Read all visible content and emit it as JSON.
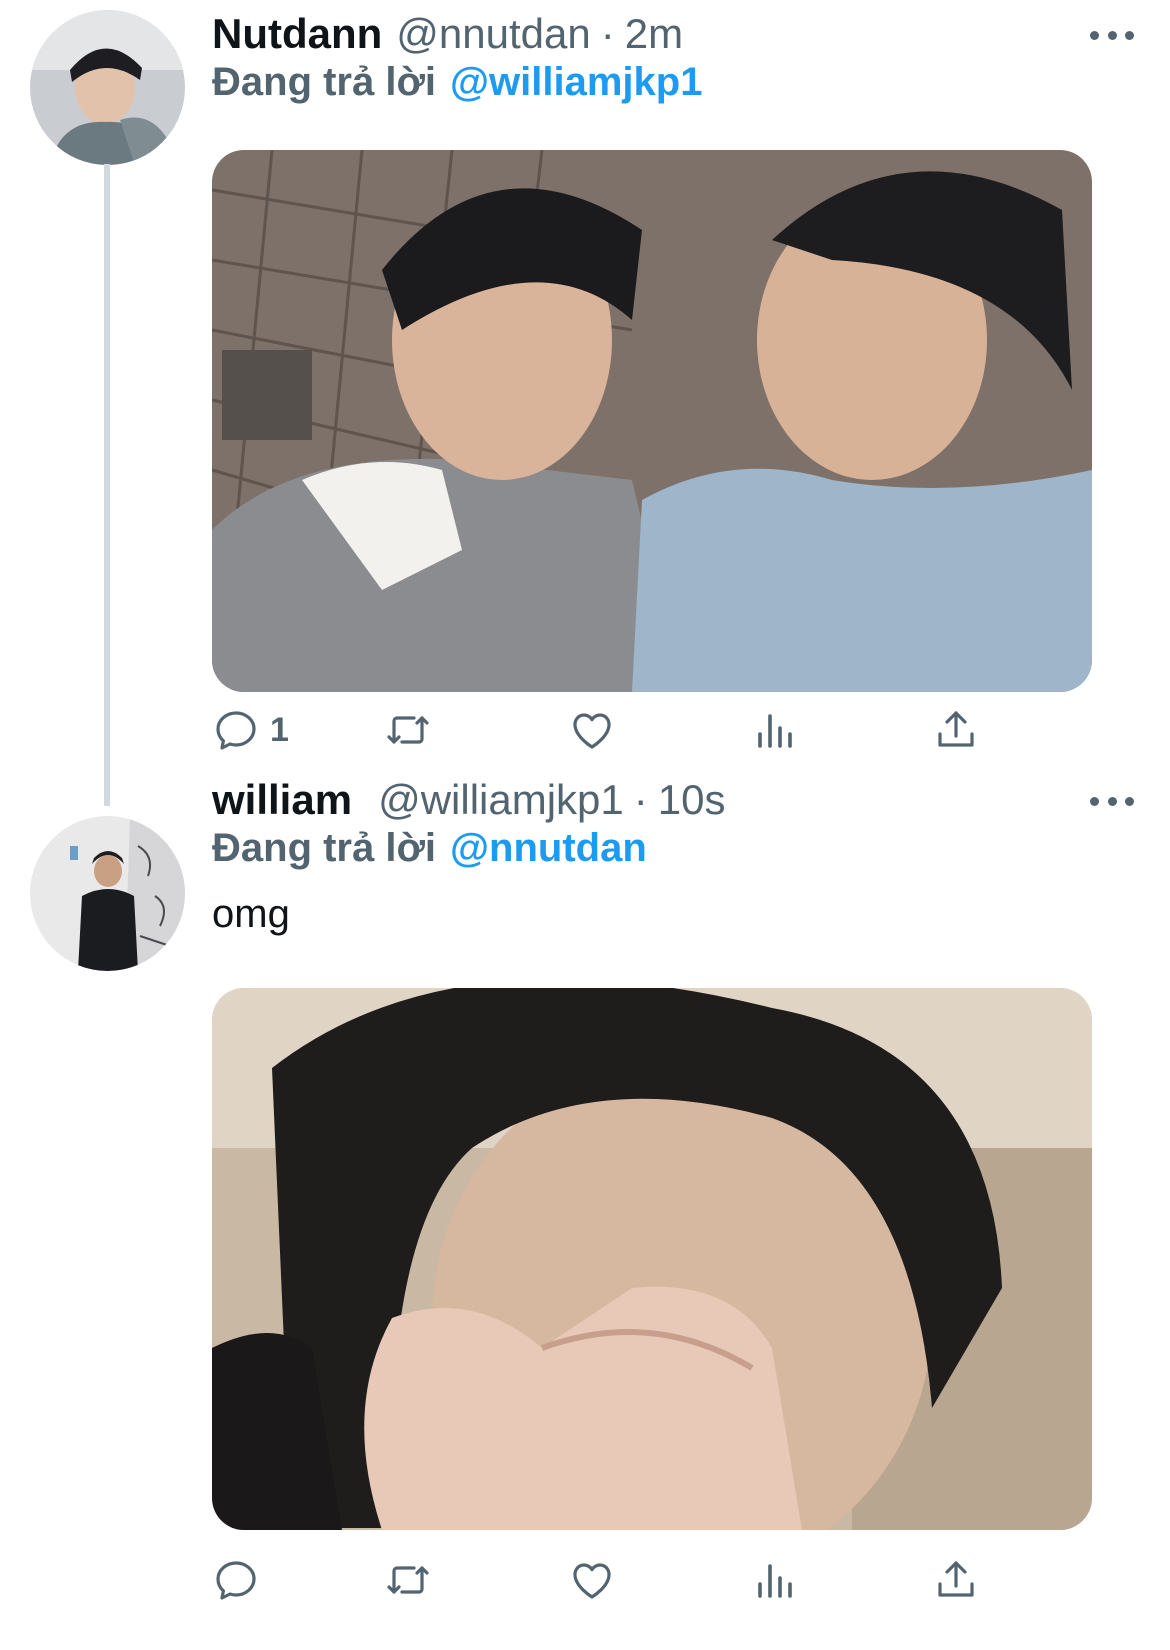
{
  "tweets": [
    {
      "display_name": "Nutdann",
      "handle": "@nnutdan",
      "separator": "·",
      "time": "2m",
      "reply_prefix": "Đang trả lời",
      "reply_mention": "@williamjkp1",
      "text": "",
      "reply_count": "1"
    },
    {
      "display_name": "william",
      "handle": "@williamjkp1",
      "separator": "·",
      "time": "10s",
      "reply_prefix": "Đang trả lời",
      "reply_mention": "@nnutdan",
      "text": "omg",
      "reply_count": ""
    }
  ],
  "icons": {
    "reply": "reply-icon",
    "retweet": "retweet-icon",
    "like": "heart-icon",
    "views": "views-icon",
    "share": "share-icon",
    "more": "more-icon"
  },
  "colors": {
    "link": "#1d9bf0",
    "secondary_text": "#536471",
    "primary_text": "#0f1419",
    "thread_line": "#cfd9de"
  }
}
